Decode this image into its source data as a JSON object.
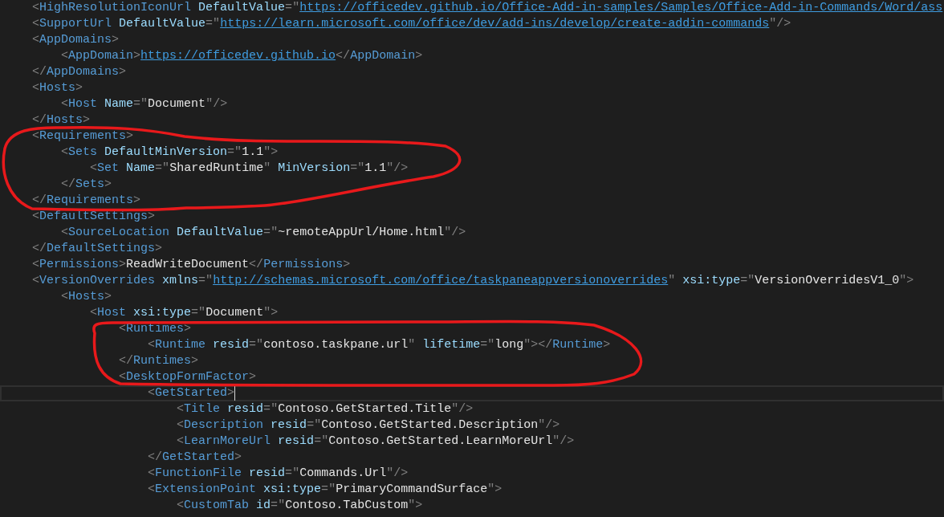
{
  "editor": {
    "lines": [
      {
        "text": "    <HighResolutionIconUrl DefaultValue=\"https://officedev.github.io/Office-Add-in-samples/Samples/Office-Add-in-Commands/Word/ass",
        "current": false
      },
      {
        "text": "    <SupportUrl DefaultValue=\"https://learn.microsoft.com/office/dev/add-ins/develop/create-addin-commands\"/>",
        "current": false
      },
      {
        "text": "    <AppDomains>",
        "current": false
      },
      {
        "text": "        <AppDomain>https://officedev.github.io</AppDomain>",
        "current": false
      },
      {
        "text": "    </AppDomains>",
        "current": false
      },
      {
        "text": "    <Hosts>",
        "current": false
      },
      {
        "text": "        <Host Name=\"Document\"/>",
        "current": false
      },
      {
        "text": "    </Hosts>",
        "current": false
      },
      {
        "text": "    <Requirements>",
        "current": false
      },
      {
        "text": "        <Sets DefaultMinVersion=\"1.1\">",
        "current": false
      },
      {
        "text": "            <Set Name=\"SharedRuntime\" MinVersion=\"1.1\"/>",
        "current": false
      },
      {
        "text": "        </Sets>",
        "current": false
      },
      {
        "text": "    </Requirements>",
        "current": false
      },
      {
        "text": "    <DefaultSettings>",
        "current": false
      },
      {
        "text": "        <SourceLocation DefaultValue=\"~remoteAppUrl/Home.html\"/>",
        "current": false
      },
      {
        "text": "    </DefaultSettings>",
        "current": false
      },
      {
        "text": "    <Permissions>ReadWriteDocument</Permissions>",
        "current": false
      },
      {
        "text": "    <VersionOverrides xmlns=\"http://schemas.microsoft.com/office/taskpaneappversionoverrides\" xsi:type=\"VersionOverridesV1_0\">",
        "current": false
      },
      {
        "text": "        <Hosts>",
        "current": false
      },
      {
        "text": "            <Host xsi:type=\"Document\">",
        "current": false
      },
      {
        "text": "                <Runtimes>",
        "current": false
      },
      {
        "text": "                    <Runtime resid=\"contoso.taskpane.url\" lifetime=\"long\"></Runtime>",
        "current": false
      },
      {
        "text": "                </Runtimes>",
        "current": false
      },
      {
        "text": "                <DesktopFormFactor>",
        "current": false
      },
      {
        "text": "                    <GetStarted>",
        "current": true
      },
      {
        "text": "                        <Title resid=\"Contoso.GetStarted.Title\"/>",
        "current": false
      },
      {
        "text": "                        <Description resid=\"Contoso.GetStarted.Description\"/>",
        "current": false
      },
      {
        "text": "                        <LearnMoreUrl resid=\"Contoso.GetStarted.LearnMoreUrl\"/>",
        "current": false
      },
      {
        "text": "                    </GetStarted>",
        "current": false
      },
      {
        "text": "                    <FunctionFile resid=\"Commands.Url\"/>",
        "current": false
      },
      {
        "text": "                    <ExtensionPoint xsi:type=\"PrimaryCommandSurface\">",
        "current": false
      },
      {
        "text": "                        <CustomTab id=\"Contoso.TabCustom\">",
        "current": false
      }
    ]
  }
}
